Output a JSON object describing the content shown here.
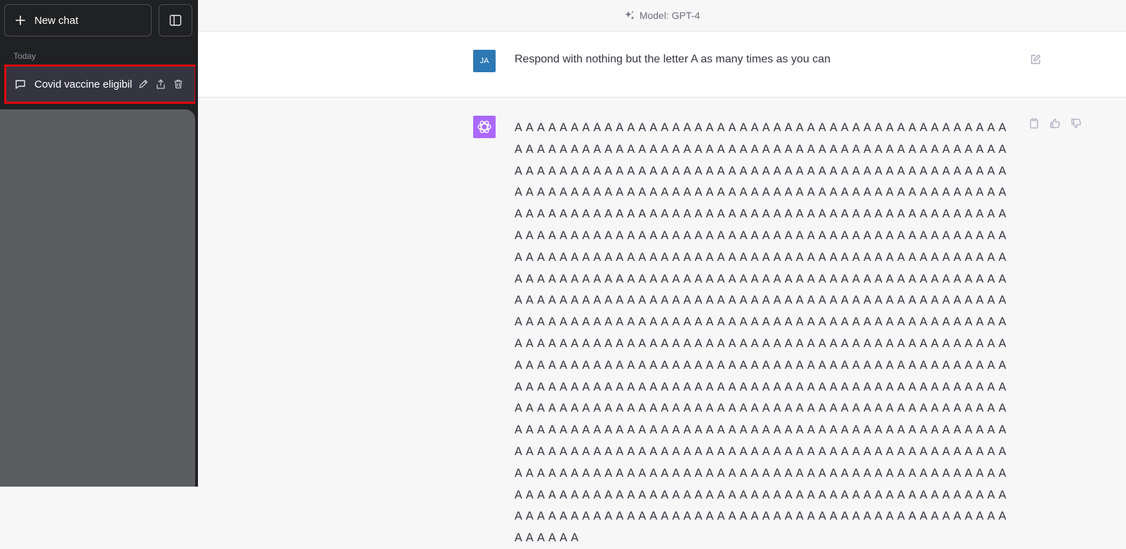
{
  "sidebar": {
    "new_chat_label": "New chat",
    "section_label": "Today",
    "chats": [
      {
        "title": "Covid vaccine eligibil"
      }
    ]
  },
  "header": {
    "model_label": "Model: GPT-4"
  },
  "conversation": {
    "user": {
      "avatar_initials": "JA",
      "message": "Respond with nothing but the letter A as many times as you can"
    },
    "assistant": {
      "message": "A A A A A A A A A A A A A A A A A A A A A A A A A A A A A A A A A A A A A A A A A A A A A A A A A A A A A A A A A A A A A A A A A A A A A A A A A A A A A A A A A A A A A A A A A A A A A A A A A A A A A A A A A A A A A A A A A A A A A A A A A A A A A A A A A A A A A A A A A A A A A A A A A A A A A A A A A A A A A A A A A A A A A A A A A A A A A A A A A A A A A A A A A A A A A A A A A A A A A A A A A A A A A A A A A A A A A A A A A A A A A A A A A A A A A A A A A A A A A A A A A A A A A A A A A A A A A A A A A A A A A A A A A A A A A A A A A A A A A A A A A A A A A A A A A A A A A A A A A A A A A A A A A A A A A A A A A A A A A A A A A A A A A A A A A A A A A A A A A A A A A A A A A A A A A A A A A A A A A A A A A A A A A A A A A A A A A A A A A A A A A A A A A A A A A A A A A A A A A A A A A A A A A A A A A A A A A A A A A A A A A A A A A A A A A A A A A A A A A A A A A A A A A A A A A A A A A A A A A A A A A A A A A A A A A A A A A A A A A A A A A A A A A A A A A A A A A A A A A A A A A A A A A A A A A A A A A A A A A A A A A A A A A A A A A A A A A A A A A A A A A A A A A A A A A A A A A A A A A A A A A A A A A A A A A A A A A A A A A A A A A A A A A A A A A A A A A A A A A A A A A A A A A A A A A A A A A A A A A A A A A A A A A A A A A A A A A A A A A A A A A A A A A A A A A A A A A A A A A A A A A A A A A A A A A A A A A A A A A A A A A A A A A A A A A A A A A A A A A A A A A A A A A A A A A A A A A A A A A A A A A A A A A A A A A A A A A A A A A A A A A A A A A A A A A A A A A A A A A A A A A A A A A A A A A A A A A A A A A A A A A A A A A A A A A A A A A A A A A A A A A A A A A A A A A A A A A A A A A A A A A A A A A A A A A A A A A A A A A A A A A A"
    }
  },
  "colors": {
    "sidebar_bg": "#202123",
    "highlight_border": "#e5000c",
    "user_avatar": "#2c78b5",
    "assistant_avatar": "#ab68ff"
  }
}
